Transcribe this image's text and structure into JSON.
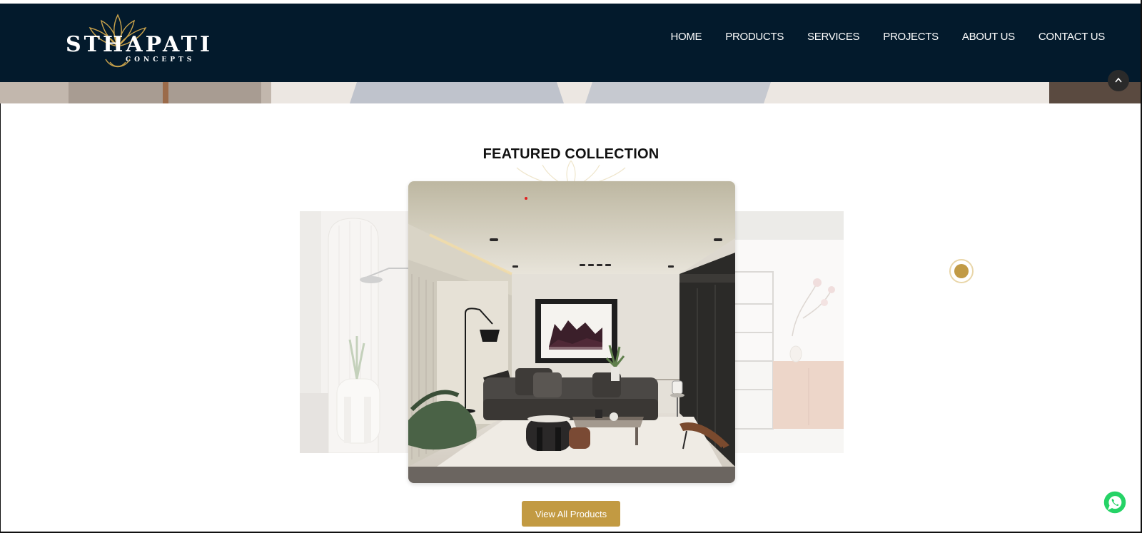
{
  "brand": {
    "name": "STHAPATI",
    "sub": "CONCEPTS"
  },
  "nav": {
    "items": [
      {
        "label": "HOME"
      },
      {
        "label": "PRODUCTS"
      },
      {
        "label": "SERVICES"
      },
      {
        "label": "PROJECTS"
      },
      {
        "label": "ABOUT US"
      },
      {
        "label": "CONTACT US"
      }
    ]
  },
  "featured": {
    "title": "FEATURED COLLECTION",
    "cta_label": "View All Products"
  },
  "colors": {
    "navbar": "#031a2c",
    "accent": "#c29a42",
    "whatsapp": "#25d366"
  },
  "icons": {
    "whatsapp": "whatsapp-icon",
    "scroll_top": "scroll-to-top-icon",
    "carousel_dot": "carousel-dot"
  }
}
